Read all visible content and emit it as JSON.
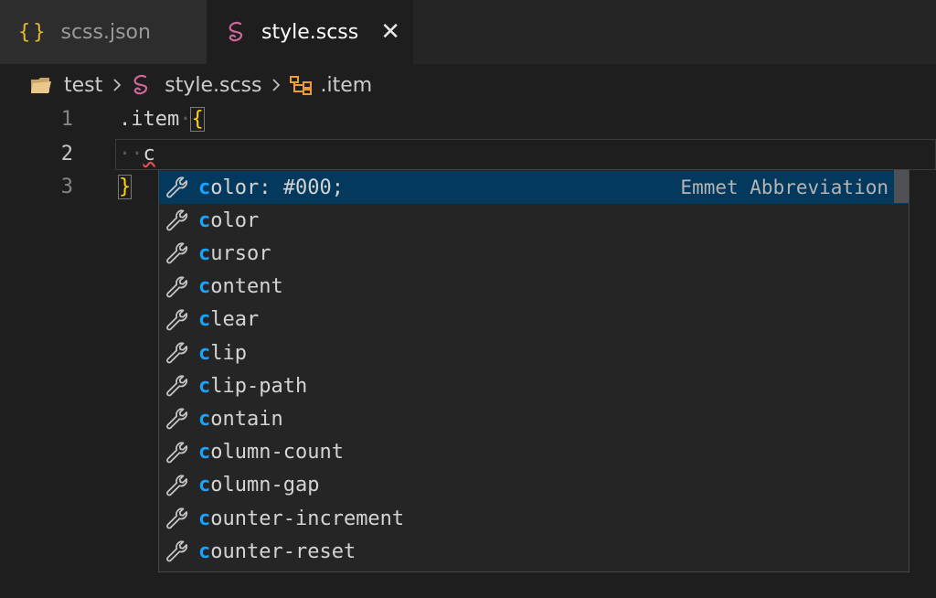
{
  "tabs": [
    {
      "label": "scss.json",
      "icon": "json-braces-icon",
      "active": false
    },
    {
      "label": "style.scss",
      "icon": "sass-icon",
      "active": true
    }
  ],
  "breadcrumb": {
    "folder": "test",
    "file": "style.scss",
    "symbol": ".item"
  },
  "editor": {
    "lines": [
      {
        "number": "1",
        "text": ".item",
        "brace": "{"
      },
      {
        "number": "2",
        "indent": "··",
        "text": "c"
      },
      {
        "number": "3",
        "brace": "}"
      }
    ]
  },
  "suggestions": {
    "detail": "Emmet Abbreviation",
    "items": [
      {
        "match": "c",
        "rest": "olor: #000;",
        "selected": true
      },
      {
        "match": "c",
        "rest": "olor"
      },
      {
        "match": "c",
        "rest": "ursor"
      },
      {
        "match": "c",
        "rest": "ontent"
      },
      {
        "match": "c",
        "rest": "lear"
      },
      {
        "match": "c",
        "rest": "lip"
      },
      {
        "match": "c",
        "rest": "lip-path"
      },
      {
        "match": "c",
        "rest": "ontain"
      },
      {
        "match": "c",
        "rest": "olumn-count"
      },
      {
        "match": "c",
        "rest": "olumn-gap"
      },
      {
        "match": "c",
        "rest": "ounter-increment"
      },
      {
        "match": "c",
        "rest": "ounter-reset"
      }
    ]
  },
  "colors": {
    "accent_match": "#18a3ff",
    "selection_bg": "#04395e",
    "brace": "#ffd700",
    "sass_pink": "#cd6799",
    "json_yellow": "#e0b72f"
  }
}
